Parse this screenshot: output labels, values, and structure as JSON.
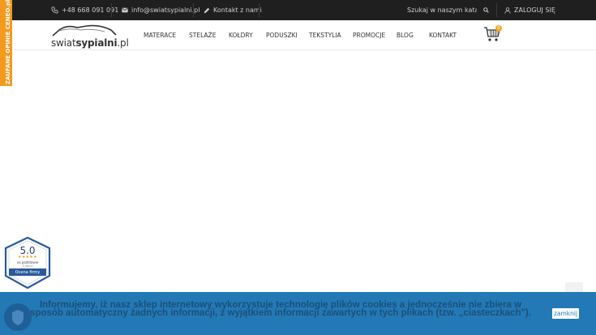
{
  "topbar": {
    "phone": "+48 668 091 091",
    "email": "info@swiatsypialni.pl",
    "contact": "Kontakt z nami",
    "search_placeholder": "Szukaj w naszym katalogu",
    "login": "ZALOGUJ SIĘ"
  },
  "header": {
    "logo_light": "swiat",
    "logo_bold": "sypialni",
    "logo_tld": ".pl",
    "nav": [
      "MATERACE",
      "STELAŻE",
      "KOŁDRY",
      "PODUSZKI",
      "TEKSTYLIA",
      "PROMOCJE",
      "BLOG",
      "KONTAKT"
    ],
    "cart_count": "0"
  },
  "ceneo_tab": {
    "label": "ZAUFANE OPINIE CENEO.pl"
  },
  "rating_badge": {
    "score": "5.0",
    "stars": "★★★★★",
    "line1": "na podstawie",
    "line2": "5 opinii",
    "ribbon": "Ocena firmy"
  },
  "cookie_bar": {
    "message": "Informujemy, iż nasz sklep internetowy wykorzystuje technologię plików cookies a jednocześnie nie zbiera w sposób automatyczny żadnych informacji, z wyjątkiem informacji zawartych w tych plikach (tzw. „ciasteczkach\").",
    "close_label": "zamknij"
  },
  "colors": {
    "topbar_bg": "#1f1f1f",
    "accent_orange": "#f39a1e",
    "cookie_bg": "#2379b5",
    "navy": "#2a3f6a"
  }
}
